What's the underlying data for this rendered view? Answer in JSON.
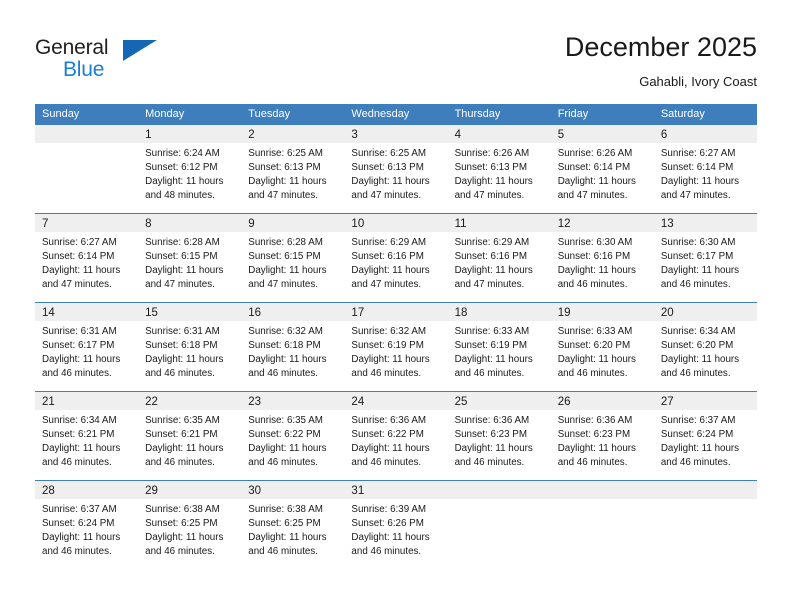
{
  "brand": {
    "name_top": "General",
    "name_bottom": "Blue",
    "accent_color": "#1567b5",
    "blue_color": "#1a7fd4"
  },
  "header": {
    "title": "December 2025",
    "subtitle": "Gahabli, Ivory Coast"
  },
  "theme": {
    "header_row_bg": "#3e7ebc",
    "header_row_text": "#ffffff",
    "day_number_bar_bg": "#efefef",
    "cell_bg": "#ffffff",
    "grid_line": "#3e7ebc",
    "text": "#1a1a1a"
  },
  "weekdays": [
    "Sunday",
    "Monday",
    "Tuesday",
    "Wednesday",
    "Thursday",
    "Friday",
    "Saturday"
  ],
  "weeks": [
    [
      {
        "day": "",
        "sunrise": "",
        "sunset": "",
        "daylight_1": "",
        "daylight_2": ""
      },
      {
        "day": "1",
        "sunrise": "Sunrise: 6:24 AM",
        "sunset": "Sunset: 6:12 PM",
        "daylight_1": "Daylight: 11 hours",
        "daylight_2": "and 48 minutes."
      },
      {
        "day": "2",
        "sunrise": "Sunrise: 6:25 AM",
        "sunset": "Sunset: 6:13 PM",
        "daylight_1": "Daylight: 11 hours",
        "daylight_2": "and 47 minutes."
      },
      {
        "day": "3",
        "sunrise": "Sunrise: 6:25 AM",
        "sunset": "Sunset: 6:13 PM",
        "daylight_1": "Daylight: 11 hours",
        "daylight_2": "and 47 minutes."
      },
      {
        "day": "4",
        "sunrise": "Sunrise: 6:26 AM",
        "sunset": "Sunset: 6:13 PM",
        "daylight_1": "Daylight: 11 hours",
        "daylight_2": "and 47 minutes."
      },
      {
        "day": "5",
        "sunrise": "Sunrise: 6:26 AM",
        "sunset": "Sunset: 6:14 PM",
        "daylight_1": "Daylight: 11 hours",
        "daylight_2": "and 47 minutes."
      },
      {
        "day": "6",
        "sunrise": "Sunrise: 6:27 AM",
        "sunset": "Sunset: 6:14 PM",
        "daylight_1": "Daylight: 11 hours",
        "daylight_2": "and 47 minutes."
      }
    ],
    [
      {
        "day": "7",
        "sunrise": "Sunrise: 6:27 AM",
        "sunset": "Sunset: 6:14 PM",
        "daylight_1": "Daylight: 11 hours",
        "daylight_2": "and 47 minutes."
      },
      {
        "day": "8",
        "sunrise": "Sunrise: 6:28 AM",
        "sunset": "Sunset: 6:15 PM",
        "daylight_1": "Daylight: 11 hours",
        "daylight_2": "and 47 minutes."
      },
      {
        "day": "9",
        "sunrise": "Sunrise: 6:28 AM",
        "sunset": "Sunset: 6:15 PM",
        "daylight_1": "Daylight: 11 hours",
        "daylight_2": "and 47 minutes."
      },
      {
        "day": "10",
        "sunrise": "Sunrise: 6:29 AM",
        "sunset": "Sunset: 6:16 PM",
        "daylight_1": "Daylight: 11 hours",
        "daylight_2": "and 47 minutes."
      },
      {
        "day": "11",
        "sunrise": "Sunrise: 6:29 AM",
        "sunset": "Sunset: 6:16 PM",
        "daylight_1": "Daylight: 11 hours",
        "daylight_2": "and 47 minutes."
      },
      {
        "day": "12",
        "sunrise": "Sunrise: 6:30 AM",
        "sunset": "Sunset: 6:16 PM",
        "daylight_1": "Daylight: 11 hours",
        "daylight_2": "and 46 minutes."
      },
      {
        "day": "13",
        "sunrise": "Sunrise: 6:30 AM",
        "sunset": "Sunset: 6:17 PM",
        "daylight_1": "Daylight: 11 hours",
        "daylight_2": "and 46 minutes."
      }
    ],
    [
      {
        "day": "14",
        "sunrise": "Sunrise: 6:31 AM",
        "sunset": "Sunset: 6:17 PM",
        "daylight_1": "Daylight: 11 hours",
        "daylight_2": "and 46 minutes."
      },
      {
        "day": "15",
        "sunrise": "Sunrise: 6:31 AM",
        "sunset": "Sunset: 6:18 PM",
        "daylight_1": "Daylight: 11 hours",
        "daylight_2": "and 46 minutes."
      },
      {
        "day": "16",
        "sunrise": "Sunrise: 6:32 AM",
        "sunset": "Sunset: 6:18 PM",
        "daylight_1": "Daylight: 11 hours",
        "daylight_2": "and 46 minutes."
      },
      {
        "day": "17",
        "sunrise": "Sunrise: 6:32 AM",
        "sunset": "Sunset: 6:19 PM",
        "daylight_1": "Daylight: 11 hours",
        "daylight_2": "and 46 minutes."
      },
      {
        "day": "18",
        "sunrise": "Sunrise: 6:33 AM",
        "sunset": "Sunset: 6:19 PM",
        "daylight_1": "Daylight: 11 hours",
        "daylight_2": "and 46 minutes."
      },
      {
        "day": "19",
        "sunrise": "Sunrise: 6:33 AM",
        "sunset": "Sunset: 6:20 PM",
        "daylight_1": "Daylight: 11 hours",
        "daylight_2": "and 46 minutes."
      },
      {
        "day": "20",
        "sunrise": "Sunrise: 6:34 AM",
        "sunset": "Sunset: 6:20 PM",
        "daylight_1": "Daylight: 11 hours",
        "daylight_2": "and 46 minutes."
      }
    ],
    [
      {
        "day": "21",
        "sunrise": "Sunrise: 6:34 AM",
        "sunset": "Sunset: 6:21 PM",
        "daylight_1": "Daylight: 11 hours",
        "daylight_2": "and 46 minutes."
      },
      {
        "day": "22",
        "sunrise": "Sunrise: 6:35 AM",
        "sunset": "Sunset: 6:21 PM",
        "daylight_1": "Daylight: 11 hours",
        "daylight_2": "and 46 minutes."
      },
      {
        "day": "23",
        "sunrise": "Sunrise: 6:35 AM",
        "sunset": "Sunset: 6:22 PM",
        "daylight_1": "Daylight: 11 hours",
        "daylight_2": "and 46 minutes."
      },
      {
        "day": "24",
        "sunrise": "Sunrise: 6:36 AM",
        "sunset": "Sunset: 6:22 PM",
        "daylight_1": "Daylight: 11 hours",
        "daylight_2": "and 46 minutes."
      },
      {
        "day": "25",
        "sunrise": "Sunrise: 6:36 AM",
        "sunset": "Sunset: 6:23 PM",
        "daylight_1": "Daylight: 11 hours",
        "daylight_2": "and 46 minutes."
      },
      {
        "day": "26",
        "sunrise": "Sunrise: 6:36 AM",
        "sunset": "Sunset: 6:23 PM",
        "daylight_1": "Daylight: 11 hours",
        "daylight_2": "and 46 minutes."
      },
      {
        "day": "27",
        "sunrise": "Sunrise: 6:37 AM",
        "sunset": "Sunset: 6:24 PM",
        "daylight_1": "Daylight: 11 hours",
        "daylight_2": "and 46 minutes."
      }
    ],
    [
      {
        "day": "28",
        "sunrise": "Sunrise: 6:37 AM",
        "sunset": "Sunset: 6:24 PM",
        "daylight_1": "Daylight: 11 hours",
        "daylight_2": "and 46 minutes."
      },
      {
        "day": "29",
        "sunrise": "Sunrise: 6:38 AM",
        "sunset": "Sunset: 6:25 PM",
        "daylight_1": "Daylight: 11 hours",
        "daylight_2": "and 46 minutes."
      },
      {
        "day": "30",
        "sunrise": "Sunrise: 6:38 AM",
        "sunset": "Sunset: 6:25 PM",
        "daylight_1": "Daylight: 11 hours",
        "daylight_2": "and 46 minutes."
      },
      {
        "day": "31",
        "sunrise": "Sunrise: 6:39 AM",
        "sunset": "Sunset: 6:26 PM",
        "daylight_1": "Daylight: 11 hours",
        "daylight_2": "and 46 minutes."
      },
      {
        "day": "",
        "sunrise": "",
        "sunset": "",
        "daylight_1": "",
        "daylight_2": ""
      },
      {
        "day": "",
        "sunrise": "",
        "sunset": "",
        "daylight_1": "",
        "daylight_2": ""
      },
      {
        "day": "",
        "sunrise": "",
        "sunset": "",
        "daylight_1": "",
        "daylight_2": ""
      }
    ]
  ]
}
